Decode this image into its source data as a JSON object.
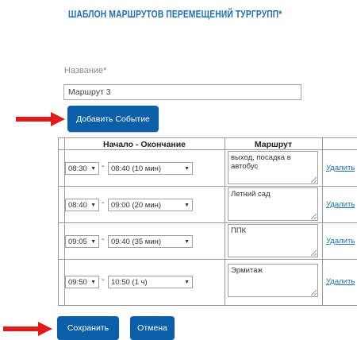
{
  "page": {
    "title": "ШАБЛОН МАРШРУТОВ ПЕРЕМЕЩЕНИЙ ТУРГРУПП*"
  },
  "form": {
    "name_label": "Название*",
    "name_value": "Маршрут 3",
    "add_event_label": "Добавить Событие",
    "save_label": "Сохранить",
    "cancel_label": "Отмена"
  },
  "table": {
    "headers": [
      "Начало - Окончание",
      "Маршрут"
    ],
    "rows": [
      {
        "start": "08:30",
        "end": "08:40 (10 мин)",
        "route": "выход, посадка в автобус",
        "delete": "Удалить"
      },
      {
        "start": "08:40",
        "end": "09:00 (20 мин)",
        "route": "Летний сад",
        "delete": "Удалить"
      },
      {
        "start": "09:05",
        "end": "09:40 (35 мин)",
        "route": "ППК",
        "delete": "Удалить"
      },
      {
        "start": "09:50",
        "end": "10:50 (1 ч)",
        "route": "Эрмитаж",
        "delete": "Удалить"
      }
    ]
  },
  "icons": {
    "select_arrow": "dropdown-arrow-icon",
    "annotation": "red-arrow-icon"
  },
  "colors": {
    "accent": "#0a5fa8",
    "link": "#1e6fb5",
    "annotation": "#e01b1b"
  }
}
